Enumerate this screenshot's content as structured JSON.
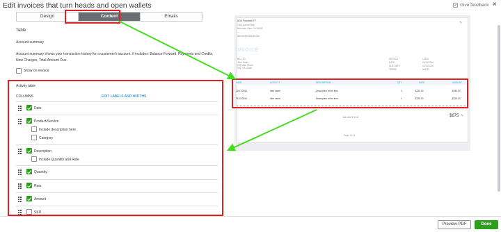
{
  "header": {
    "title": "Edit invoices that turn heads and open wallets",
    "feedback": "Give feedback",
    "close": "×"
  },
  "tabs": [
    "Design",
    "Content",
    "Emails"
  ],
  "left": {
    "table_heading": "Table",
    "account_summary_heading": "Account summary",
    "account_summary_text_1": "Account summary shows your transaction history for a customer's account. It includes: Balance Forward, Payments and Credits,",
    "account_summary_text_2": "New Charges, Total Amount Due.",
    "show_on_invoice": "Show on invoice",
    "activity_table": "Activity table",
    "columns": "COLUMNS",
    "edit_labels": "EDIT LABELS AND WIDTHS",
    "items": {
      "date": "Date",
      "product": "Product/Service",
      "include_desc": "Include description here",
      "category": "Category",
      "description": "Description",
      "include_qty": "Include Quantity and Rate",
      "quantity": "Quantity",
      "rate": "Rate",
      "amount": "Amount",
      "sku": "SKU"
    }
  },
  "preview": {
    "company": "ADV Fountain TF",
    "addr1": "1000 Nature Way",
    "addr2": "Mountain View, CA 94043",
    "addr3": "...",
    "addr4": "service@example.com",
    "invoice_title": "INVOICE",
    "bill_to": "BILL TO",
    "bill_to_name": "John Smith",
    "bill_to_addr1": "123 Main Street",
    "bill_to_addr2": "City, CA 12345",
    "meta_labels": [
      "INVOICE",
      "DATE",
      "DUE DATE",
      "TERMS"
    ],
    "meta_values": [
      "12345",
      "01/10/2016",
      "01/10/2016",
      "Net 30"
    ],
    "col_headers": [
      "DATE",
      "ACTIVITY",
      "DESCRIPTION",
      "QTY",
      "RATE",
      "AMOUNT"
    ],
    "rows": [
      [
        "12/01/2016",
        "Item name",
        "Description of the item",
        "2",
        "$225.00",
        "$450.00"
      ],
      [
        "01/12/2016",
        "Item name",
        "Description of the item",
        "1",
        "$225.00",
        "$225.00"
      ]
    ],
    "balance_due": "BALANCE DUE",
    "balance_amount": "$675",
    "page_num": "Page 1 of 1"
  },
  "footer": {
    "preview_pdf": "Preview PDF",
    "done": "Done"
  },
  "annotations": {
    "highlight_color": "#e02020",
    "arrow_color": "#44dd22"
  }
}
